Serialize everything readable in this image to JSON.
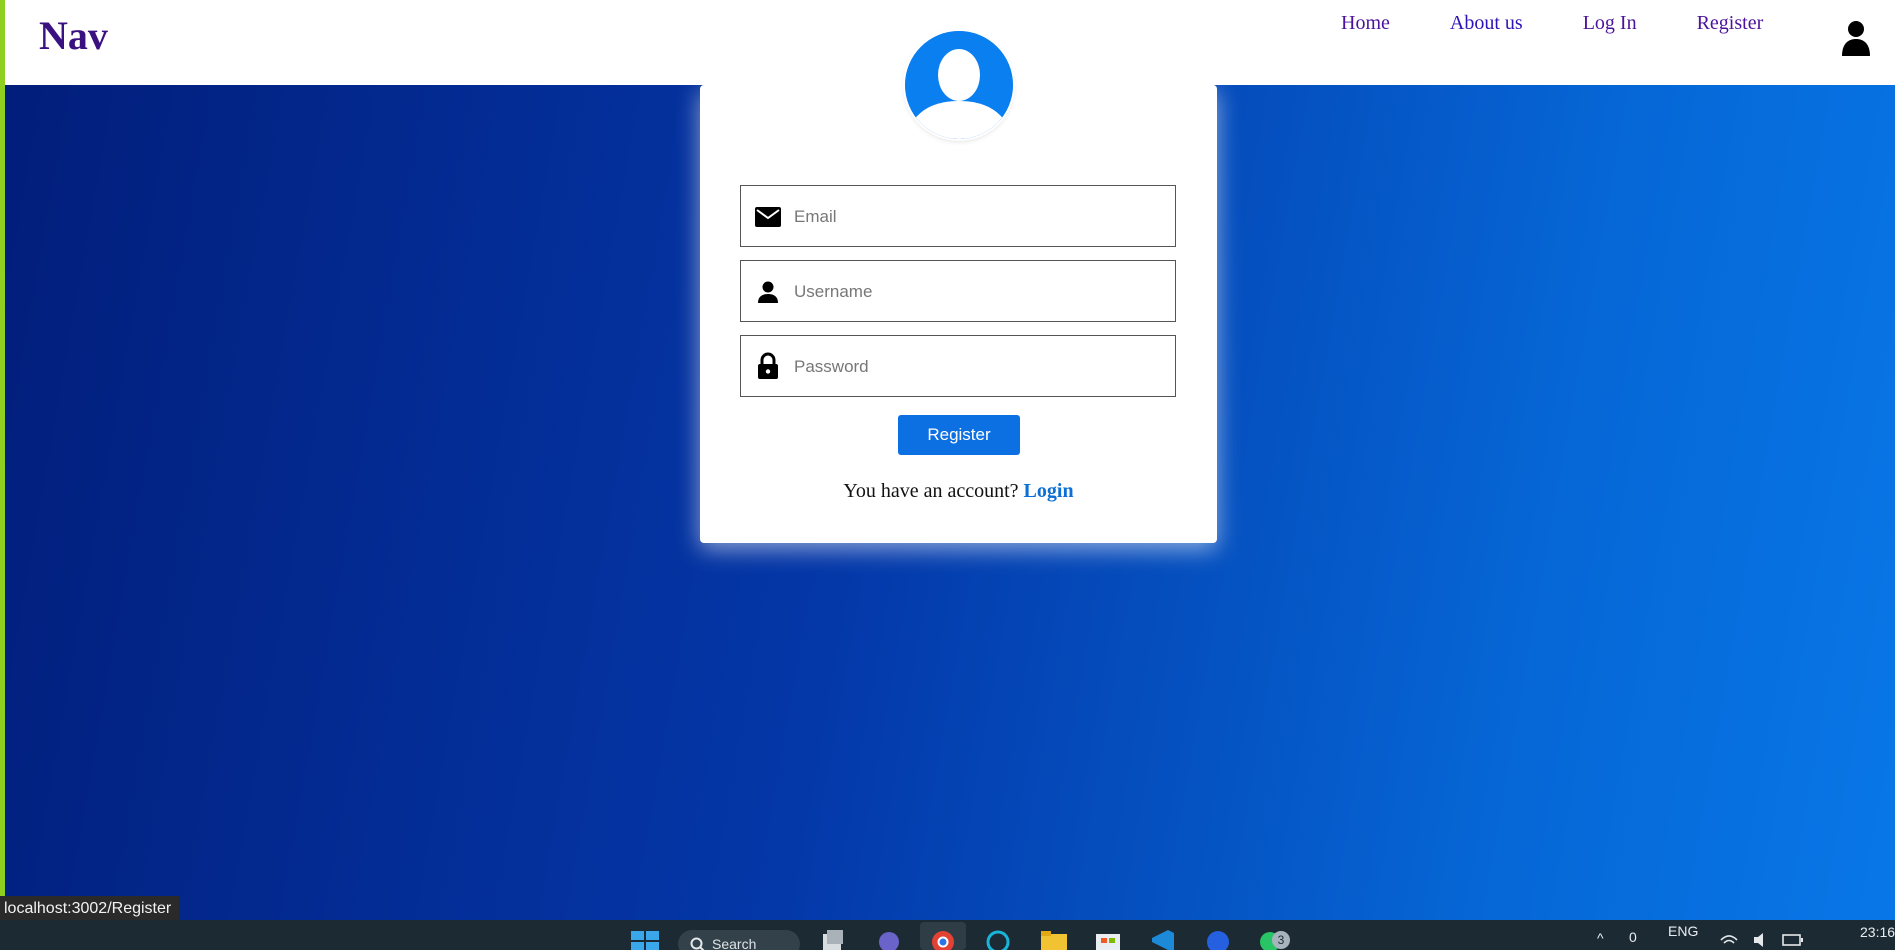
{
  "nav": {
    "brand": "Nav",
    "links": [
      {
        "label": "Home"
      },
      {
        "label": "About us"
      },
      {
        "label": "Log In"
      },
      {
        "label": "Register"
      }
    ],
    "user_icon": "user-icon"
  },
  "form": {
    "avatar_icon": "avatar-icon",
    "email": {
      "placeholder": "Email",
      "value": "",
      "icon": "mail-icon"
    },
    "username": {
      "placeholder": "Username",
      "value": "",
      "icon": "person-icon"
    },
    "password": {
      "placeholder": "Password",
      "value": "",
      "icon": "lock-icon"
    },
    "submit_label": "Register",
    "footer_text": "You have an account?",
    "footer_link": "Login"
  },
  "status_bar": {
    "url": "localhost:3002/Register"
  },
  "taskbar": {
    "search_label": "Search",
    "language": "ENG",
    "notification_count": "3",
    "tray_number": "0",
    "time": "23:16"
  },
  "colors": {
    "brand": "#3a1181",
    "accent": "#0c70e3",
    "background_start": "#021d7a",
    "background_end": "#0877e8"
  }
}
